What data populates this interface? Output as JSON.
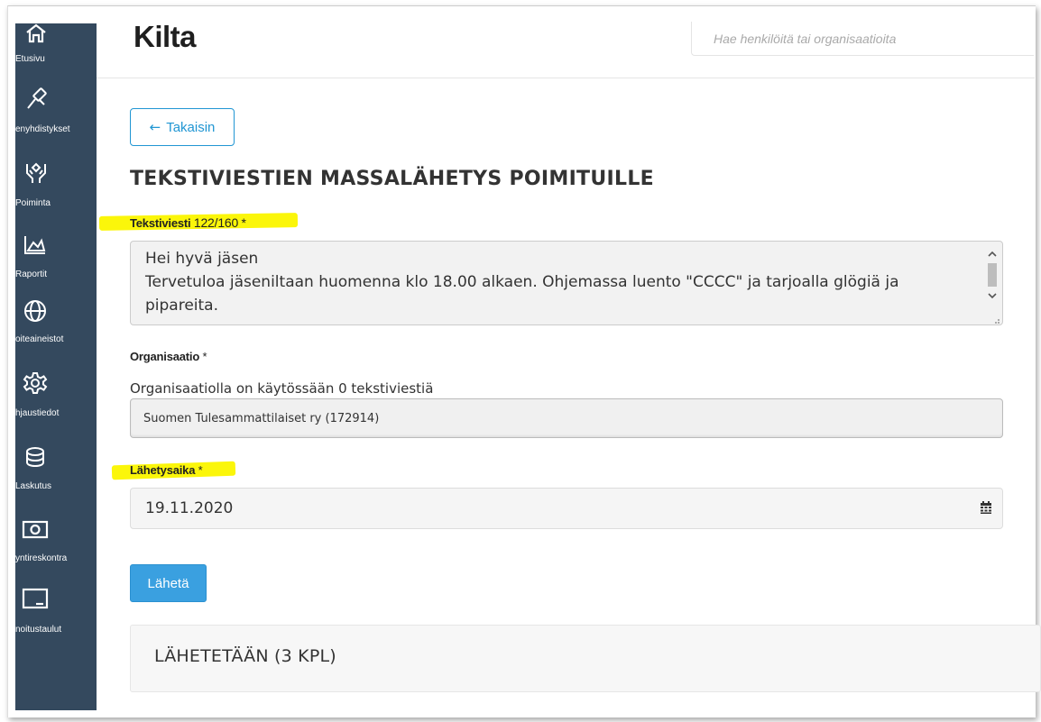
{
  "sidebar": {
    "items": [
      {
        "label": "Etusivu",
        "icon": "home-icon"
      },
      {
        "label": "enyhdistykset",
        "icon": "gavel-icon"
      },
      {
        "label": "Poiminta",
        "icon": "hands-icon"
      },
      {
        "label": "Raportit",
        "icon": "area-chart-icon"
      },
      {
        "label": "oiteaineistot",
        "icon": "globe-icon"
      },
      {
        "label": "hjaustiedot",
        "icon": "gear-icon"
      },
      {
        "label": "Laskutus",
        "icon": "coins-icon"
      },
      {
        "label": "yntireskontra",
        "icon": "money-bill-icon"
      },
      {
        "label": "noitustaulut",
        "icon": "board-icon"
      }
    ]
  },
  "header": {
    "brand": "Kilta",
    "search_placeholder": "Hae henkilöitä tai organisaatioita"
  },
  "main": {
    "back_label": "Takaisin",
    "title": "TEKSTIVIESTIEN MASSALÄHETYS POIMITUILLE",
    "message": {
      "label": "Tekstiviesti",
      "counter": "122/160",
      "required": "*",
      "value": "Hei hyvä jäsen\nTervetuloa jäseniltaan huomenna klo 18.00 alkaen. Ohjemassa luento \"CCCC\" ja tarjoalla glögiä ja pipareita."
    },
    "organization": {
      "label": "Organisaatio",
      "required": "*",
      "note": "Organisaatiolla on käytössään 0 tekstiviestiä",
      "selected": "Suomen Tulesammattilaiset ry (172914)"
    },
    "send_time": {
      "label": "Lähetysaika",
      "required": "*",
      "value": "19.11.2020"
    },
    "send_label": "Lähetä",
    "recipients_title": "LÄHETETÄÄN (3 KPL)"
  },
  "colors": {
    "sidebar": "#34495e",
    "accent": "#2196d3",
    "primary_button": "#3aa0e0",
    "highlight": "#fbf60a"
  }
}
